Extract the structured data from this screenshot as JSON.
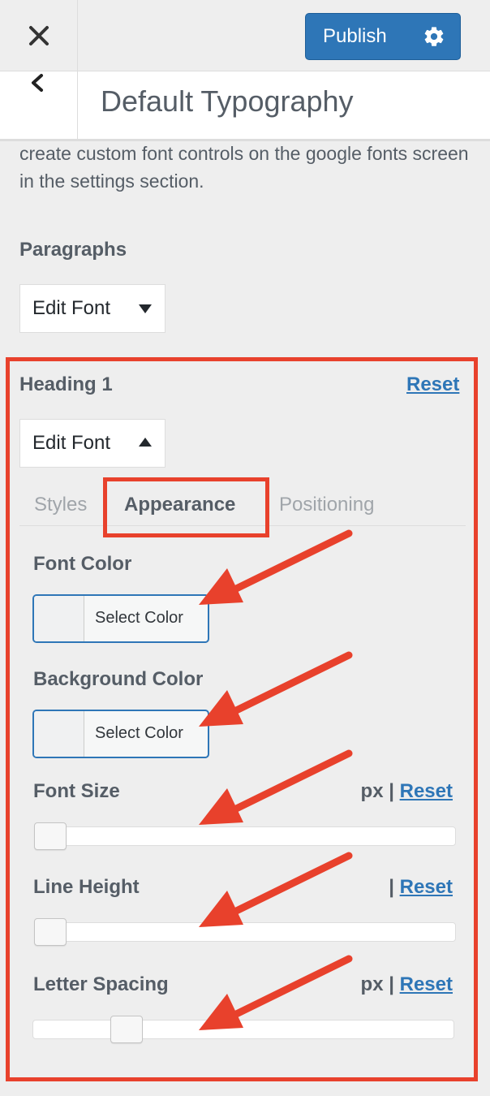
{
  "header": {
    "close_icon": "close-icon",
    "publish_label": "Publish",
    "settings_icon": "gear-icon"
  },
  "titlebar": {
    "back_icon": "chevron-left-icon",
    "title": "Default Typography"
  },
  "intro": {
    "text": "create custom font controls on the google fonts screen in the settings section."
  },
  "paragraphs": {
    "heading": "Paragraphs",
    "edit_font_label": "Edit Font"
  },
  "heading1": {
    "heading": "Heading 1",
    "reset_label": "Reset",
    "edit_font_label": "Edit Font",
    "tabs": [
      {
        "label": "Styles",
        "active": false
      },
      {
        "label": "Appearance",
        "active": true
      },
      {
        "label": "Positioning",
        "active": false
      }
    ],
    "font_color": {
      "label": "Font Color",
      "button_label": "Select Color"
    },
    "background_color": {
      "label": "Background Color",
      "button_label": "Select Color"
    },
    "font_size": {
      "label": "Font Size",
      "unit": "px",
      "separator": "|",
      "reset_label": "Reset",
      "slider_fraction": 0.0
    },
    "line_height": {
      "label": "Line Height",
      "unit": "",
      "separator": "|",
      "reset_label": "Reset",
      "slider_fraction": 0.0
    },
    "letter_spacing": {
      "label": "Letter Spacing",
      "unit": "px",
      "separator": "|",
      "reset_label": "Reset",
      "slider_fraction": 0.2
    }
  },
  "colors": {
    "accent": "#2e76b7",
    "annotation_red": "#e8412c",
    "panel_bg": "#eeeeee"
  }
}
